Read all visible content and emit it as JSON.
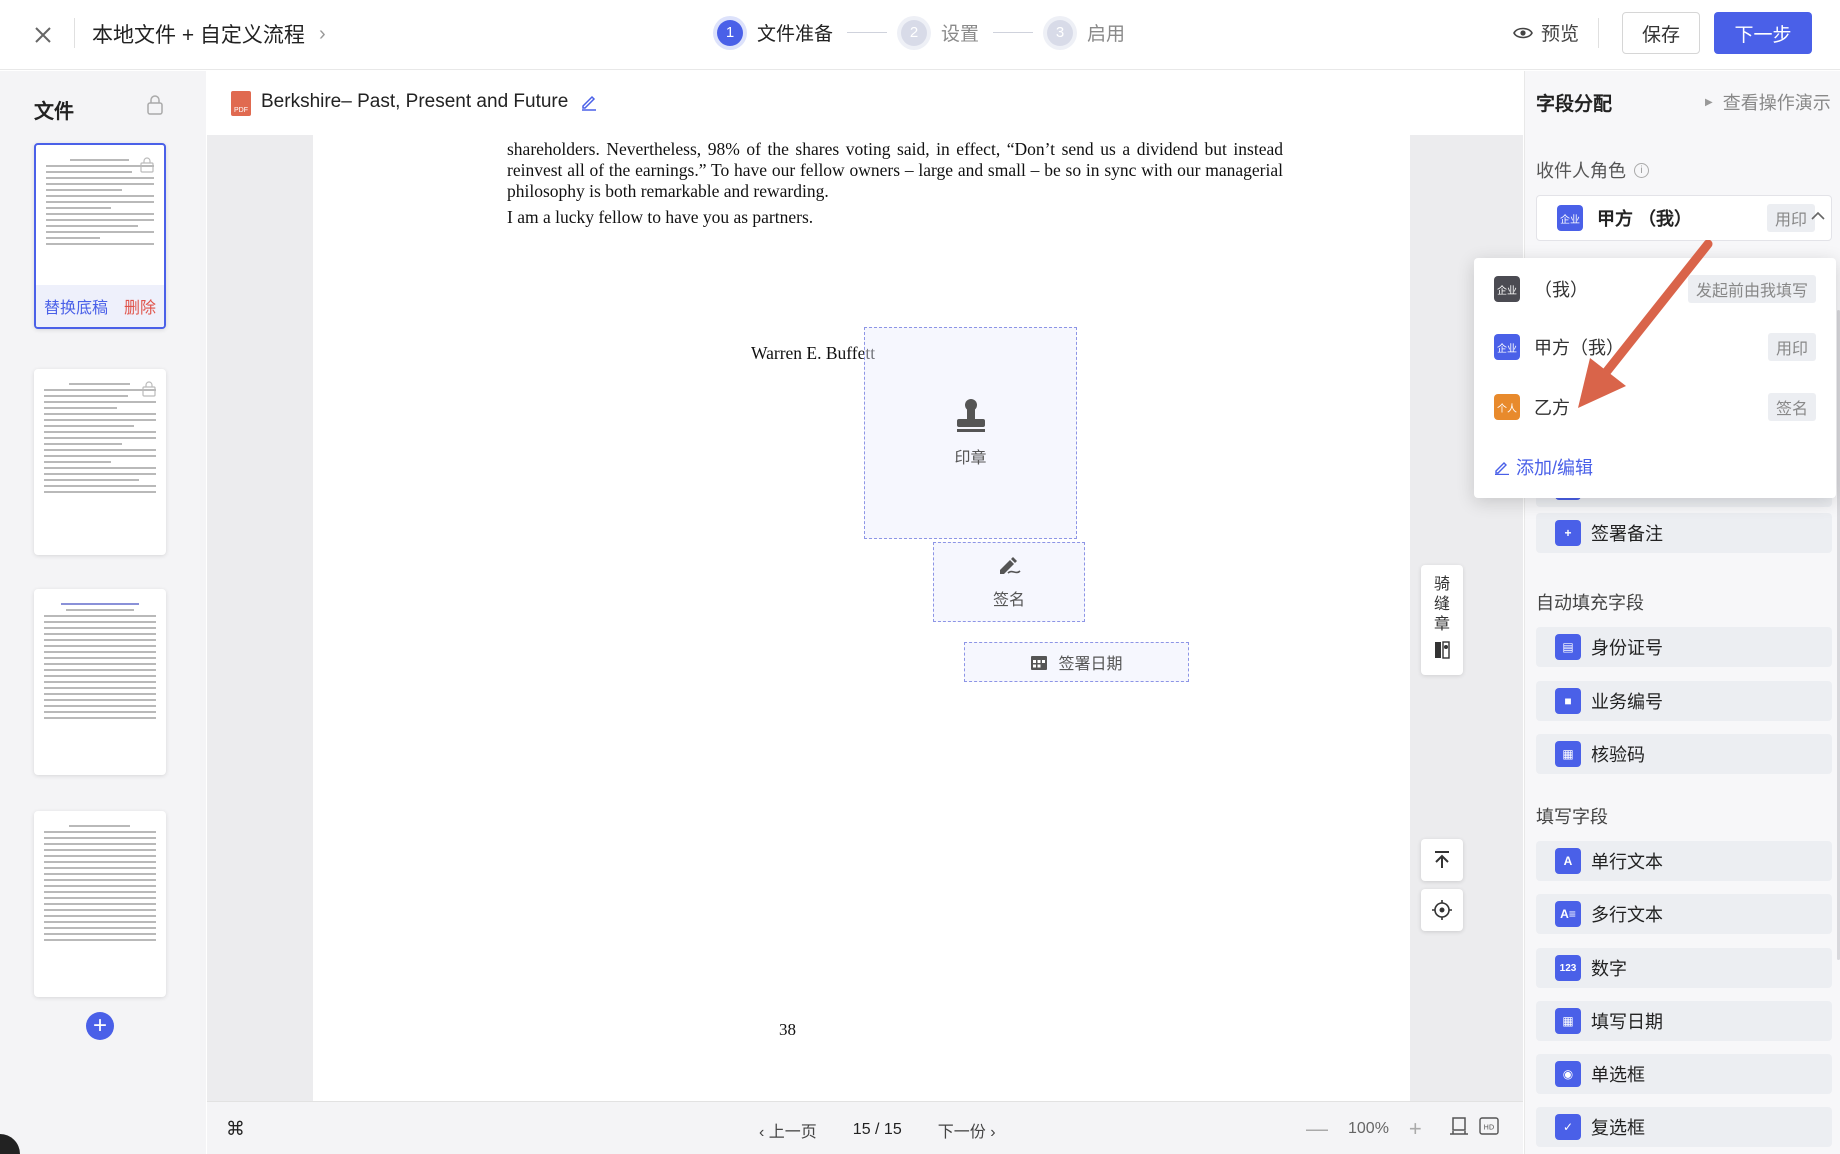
{
  "topbar": {
    "title": "本地文件 + 自定义流程",
    "title_chevron": "›",
    "steps": [
      {
        "num": "1",
        "label": "文件准备"
      },
      {
        "num": "2",
        "label": "设置"
      },
      {
        "num": "3",
        "label": "启用"
      }
    ],
    "preview_label": "预览",
    "save_label": "保存",
    "next_label": "下一步"
  },
  "left": {
    "heading": "文件",
    "replace_label": "替换底稿",
    "delete_label": "删除",
    "add_label": "+"
  },
  "doc": {
    "title": "Berkshire– Past, Present and Future",
    "pdf_tag": "PDF",
    "para1": "shareholders. Nevertheless, 98% of the shares voting said, in effect, “Don’t send us a dividend but instead reinvest all of the earnings.” To have our fellow owners – large and small – be so in sync with our managerial philosophy is both remarkable and rewarding.",
    "para2": "I am a lucky fellow to have you as partners.",
    "signature_name": "Warren E. Buffett",
    "page_number": "38"
  },
  "fields_on_page": {
    "seal_label": "印章",
    "sign_label": "签名",
    "date_label": "签署日期"
  },
  "seam_tool": {
    "chars": [
      "骑",
      "缝",
      "章"
    ]
  },
  "footer": {
    "cmd_symbol": "⌘",
    "prev_label": "上一页",
    "page_count": "15 / 15",
    "next_label": "下一份",
    "zoom_minus": "—",
    "zoom_value": "100%",
    "zoom_plus": "+",
    "hd_label": "HD"
  },
  "right": {
    "heading": "字段分配",
    "demo_label": "查看操作演示",
    "role_label": "收件人角色",
    "info_symbol": "i",
    "selected_role": {
      "badge": "企业",
      "name": "甲方 （我）",
      "tag": "用印"
    },
    "sections": {
      "sign_note": "签署备注",
      "auto_fill_title": "自动填充字段",
      "auto_fill": [
        "身份证号",
        "业务编号",
        "核验码"
      ],
      "fill_title": "填写字段",
      "fill": [
        "单行文本",
        "多行文本",
        "数字",
        "填写日期",
        "单选框",
        "复选框"
      ]
    }
  },
  "dropdown": {
    "items": [
      {
        "badge": "企业",
        "name": "（我）",
        "tag": "发起前由我填写",
        "color": "dark"
      },
      {
        "badge": "企业",
        "name": "甲方（我）",
        "tag": "用印",
        "color": "blue"
      },
      {
        "badge": "个人",
        "name": "乙方",
        "tag": "签名",
        "color": "orange"
      }
    ],
    "add_label": "添加/编辑"
  },
  "colors": {
    "accent": "#4a60e8",
    "danger": "#e0534a",
    "annotation_arrow": "#d9644a"
  }
}
